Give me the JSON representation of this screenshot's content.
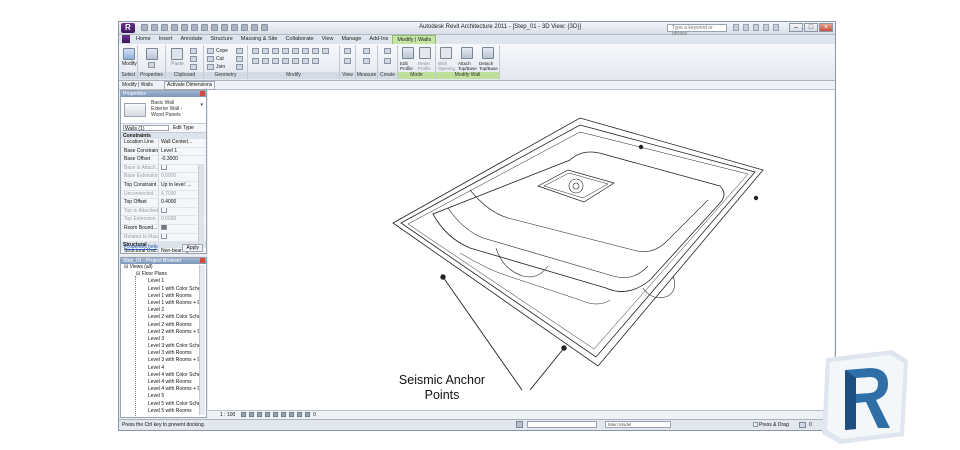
{
  "app": {
    "title": "Autodesk Revit Architecture 2011 - [Step_01 - 3D View: {3D}]",
    "search_placeholder": "Type a keyword or phrase",
    "app_menu_letter": "R"
  },
  "tabs": [
    "Home",
    "Insert",
    "Annotate",
    "Structure",
    "Massing & Site",
    "Collaborate",
    "View",
    "Manage",
    "Add-Ins",
    "Modify | Walls"
  ],
  "ribbon": {
    "panels": [
      {
        "label": "Select",
        "buttons": [
          "Modify"
        ]
      },
      {
        "label": "Properties",
        "buttons": [
          "Properties"
        ]
      },
      {
        "label": "Clipboard",
        "buttons": [
          "Paste"
        ]
      },
      {
        "label": "Geometry",
        "buttons": [
          "Cope",
          "Cut",
          "Join"
        ]
      },
      {
        "label": "Modify",
        "buttons": []
      },
      {
        "label": "View",
        "buttons": []
      },
      {
        "label": "Measure",
        "buttons": []
      },
      {
        "label": "Create",
        "buttons": []
      },
      {
        "label": "Mode",
        "buttons": [
          "Edit Profile",
          "Reset Profile"
        ]
      },
      {
        "label": "Modify Wall",
        "buttons": [
          "Wall Opening",
          "Attach Top/Base",
          "Detach Top/Base"
        ]
      }
    ]
  },
  "options_bar": {
    "selection": "Modify | Walls",
    "activate_dimensions": "Activate Dimensions"
  },
  "properties": {
    "header": "Properties",
    "type_name": "Basic Wall Exterior Wall - Wood Panels",
    "instance_filter": "Walls (1)",
    "edit_type": "Edit Type",
    "group": "Constraints",
    "rows": [
      {
        "name": "Location Line",
        "value": "Wall Centerl...",
        "dim": false
      },
      {
        "name": "Base Constraint",
        "value": "Level 1",
        "dim": false
      },
      {
        "name": "Base Offset",
        "value": "-0.3000",
        "dim": false
      },
      {
        "name": "Base is Attach...",
        "value": "",
        "check": false,
        "dim": true
      },
      {
        "name": "Base Extension...",
        "value": "0.0000",
        "dim": true
      },
      {
        "name": "Top Constraint",
        "value": "Up to level: ...",
        "dim": false
      },
      {
        "name": "Unconnected ...",
        "value": "4.7000",
        "dim": true
      },
      {
        "name": "Top Offset",
        "value": "0.4000",
        "dim": false
      },
      {
        "name": "Top is Attached",
        "value": "",
        "check": false,
        "dim": true
      },
      {
        "name": "Top Extension...",
        "value": "0.0000",
        "dim": true
      },
      {
        "name": "Room Bound...",
        "value": "",
        "check": true,
        "dim": false
      },
      {
        "name": "Related to Mass",
        "value": "",
        "check": false,
        "dim": true
      }
    ],
    "group2": "Structural",
    "rows2": [
      {
        "name": "Structural Usa...",
        "value": "Non-bearing",
        "dim": false
      }
    ],
    "help_link": "Properties help",
    "apply": "Apply"
  },
  "project_browser": {
    "header": "Step_01 - Project Browser",
    "items": [
      {
        "label": "Views (all)",
        "level": 0
      },
      {
        "label": "Floor Plans",
        "level": 1
      },
      {
        "label": "Level 1",
        "level": 2
      },
      {
        "label": "Level 1 with Color Schem",
        "level": 2
      },
      {
        "label": "Level 1 with Rooms",
        "level": 2
      },
      {
        "label": "Level 1 with Rooms + Di",
        "level": 2
      },
      {
        "label": "Level 2",
        "level": 2
      },
      {
        "label": "Level 2 with Color Schem",
        "level": 2
      },
      {
        "label": "Level 2 with Rooms",
        "level": 2
      },
      {
        "label": "Level 2 with Rooms + Di",
        "level": 2
      },
      {
        "label": "Level 3",
        "level": 2
      },
      {
        "label": "Level 3 with Color Schem",
        "level": 2
      },
      {
        "label": "Level 3 with Rooms",
        "level": 2
      },
      {
        "label": "Level 3 with Rooms + Di",
        "level": 2
      },
      {
        "label": "Level 4",
        "level": 2
      },
      {
        "label": "Level 4 with Color Schem",
        "level": 2
      },
      {
        "label": "Level 4 with Rooms",
        "level": 2
      },
      {
        "label": "Level 4 with Rooms + Di",
        "level": 2
      },
      {
        "label": "Level 5",
        "level": 2
      },
      {
        "label": "Level 5 with Color Schem",
        "level": 2
      },
      {
        "label": "Level 5 with Rooms",
        "level": 2
      }
    ]
  },
  "view_control": {
    "scale": "1 : 100",
    "count": "0"
  },
  "status": {
    "message": "Press the Ctrl key to prevent docking.",
    "model": "Main Model",
    "press_drag": "Press & Drag",
    "filter_count": "0"
  },
  "annotation": {
    "line1": "Seismic Anchor",
    "line2": "Points"
  },
  "colors": {
    "accent_purple": "#4b1e6e",
    "context_tab": "#c7e6a5",
    "logo_blue": "#2f6fa8"
  }
}
